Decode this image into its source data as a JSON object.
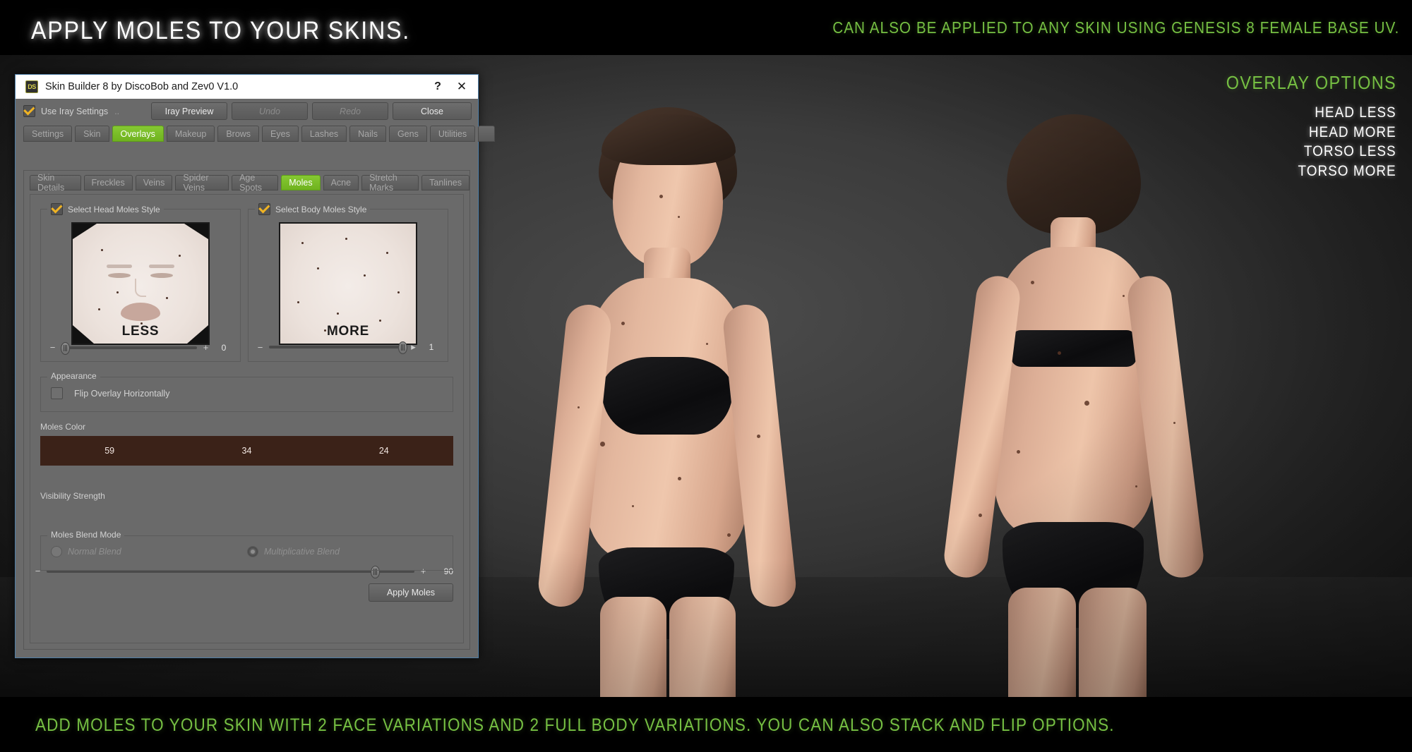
{
  "promo": {
    "title": "APPLY MOLES TO YOUR SKINS.",
    "subtitle": "CAN ALSO BE APPLIED TO ANY SKIN USING GENESIS 8 FEMALE BASE UV.",
    "bottom_caption": "ADD MOLES TO YOUR SKIN WITH 2 FACE VARIATIONS AND 2 FULL BODY VARIATIONS. YOU CAN ALSO STACK AND FLIP OPTIONS.",
    "overlay_options_title": "OVERLAY OPTIONS",
    "overlay_options": [
      "HEAD LESS",
      "HEAD MORE",
      "TORSO LESS",
      "TORSO MORE"
    ],
    "accent_green": "#76c043",
    "white": "#ffffff"
  },
  "dialog": {
    "title": "Skin Builder 8 by DiscoBob and Zev0 V1.0",
    "app_icon_label": "DS",
    "help_glyph": "?",
    "close_glyph": "✕",
    "iray_checkbox_label": "Use Iray Settings",
    "iray_checkbox_checked": true,
    "iray_suffix_dots": "..",
    "toolbar": [
      {
        "label": "Iray Preview",
        "disabled": false
      },
      {
        "label": "Undo",
        "disabled": true
      },
      {
        "label": "Redo",
        "disabled": true
      },
      {
        "label": "Close",
        "disabled": false
      }
    ],
    "tabs": [
      {
        "label": "Settings",
        "active": false
      },
      {
        "label": "Skin",
        "active": false
      },
      {
        "label": "Overlays",
        "active": true
      },
      {
        "label": "Makeup",
        "active": false
      },
      {
        "label": "Brows",
        "active": false
      },
      {
        "label": "Eyes",
        "active": false
      },
      {
        "label": "Lashes",
        "active": false
      },
      {
        "label": "Nails",
        "active": false
      },
      {
        "label": "Gens",
        "active": false
      },
      {
        "label": "Utilities",
        "active": false
      }
    ],
    "subtabs": [
      {
        "label": "Skin Details",
        "active": false
      },
      {
        "label": "Freckles",
        "active": false
      },
      {
        "label": "Veins",
        "active": false
      },
      {
        "label": "Spider Veins",
        "active": false
      },
      {
        "label": "Age Spots",
        "active": false
      },
      {
        "label": "Moles",
        "active": true
      },
      {
        "label": "Acne",
        "active": false
      },
      {
        "label": "Stretch Marks",
        "active": false
      },
      {
        "label": "Tanlines",
        "active": false
      }
    ],
    "head_style": {
      "group_label": "Select Head Moles Style",
      "checked": true,
      "thumb_caption": "LESS",
      "slider_value": "0",
      "slider_percent": 2,
      "minus": "−",
      "plus": "+"
    },
    "body_style": {
      "group_label": "Select Body Moles Style",
      "checked": true,
      "thumb_caption": "MORE",
      "slider_value": "1",
      "slider_percent": 98,
      "minus": "−",
      "plus": "▸"
    },
    "appearance": {
      "group_label": "Appearance",
      "flip_label": "Flip Overlay Horizontally",
      "flip_checked": false
    },
    "moles_color": {
      "label": "Moles Color",
      "r": "59",
      "g": "34",
      "b": "24",
      "hex": "#3b2218"
    },
    "visibility": {
      "label": "Visibility Strength",
      "value": "90",
      "percent": 89,
      "minus": "−",
      "plus": "+"
    },
    "blend_mode": {
      "group_label": "Moles Blend Mode",
      "options": [
        {
          "label": "Normal Blend",
          "selected": false
        },
        {
          "label": "Multiplicative Blend",
          "selected": true
        }
      ]
    },
    "apply_button": "Apply Moles"
  }
}
